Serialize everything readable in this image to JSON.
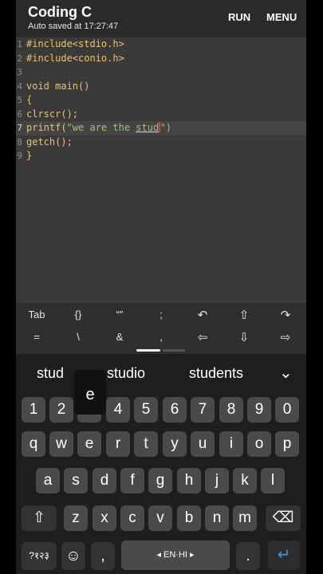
{
  "app": {
    "title": "Coding C",
    "autosave": "Auto saved at 17:27:47",
    "run_label": "RUN",
    "menu_label": "MENU"
  },
  "editor": {
    "lines": [
      {
        "num": "1",
        "text": "#include<stdio.h>"
      },
      {
        "num": "2",
        "text": "#include<conio.h>"
      },
      {
        "num": "3",
        "text": ""
      },
      {
        "num": "4",
        "text": "void main()"
      },
      {
        "num": "5",
        "text": "{"
      },
      {
        "num": "6",
        "text": "clrscr();"
      },
      {
        "num": "7",
        "pre": "printf(",
        "str_start": "\"we are the ",
        "str_word": "stud",
        "post": "\")"
      },
      {
        "num": "8",
        "text": "getch();"
      },
      {
        "num": "9",
        "text": "}"
      }
    ],
    "current_line": 7
  },
  "symbols": {
    "row1": [
      "Tab",
      "{}",
      "“”",
      ";",
      "↶",
      "⇧",
      "↷"
    ],
    "row2": [
      "=",
      "\\",
      "&",
      ",",
      "⇦",
      "⇩",
      "⇨"
    ]
  },
  "keyboard": {
    "suggestions": [
      "stud",
      "studio",
      "students"
    ],
    "expand_icon": "⌄",
    "popup_key": "e",
    "row_numbers": [
      "1",
      "2",
      "3",
      "4",
      "5",
      "6",
      "7",
      "8",
      "9",
      "0"
    ],
    "row_q": [
      "q",
      "w",
      "e",
      "r",
      "t",
      "y",
      "u",
      "i",
      "o",
      "p"
    ],
    "row_a": [
      "a",
      "s",
      "d",
      "f",
      "g",
      "h",
      "j",
      "k",
      "l"
    ],
    "row_z": [
      "z",
      "x",
      "c",
      "v",
      "b",
      "n",
      "m"
    ],
    "shift_icon": "⇧",
    "backspace_icon": "⌫",
    "symbols_key": "?१२३",
    "emoji_icon": "☺",
    "comma_key": ",",
    "space_label": "◂ EN·HI ▸",
    "period_key": ".",
    "enter_icon": "↵"
  },
  "colors": {
    "keyword": "#e8c36a",
    "string": "#9fc17a",
    "caret": "#e04040",
    "enter": "#3f8ee8"
  }
}
